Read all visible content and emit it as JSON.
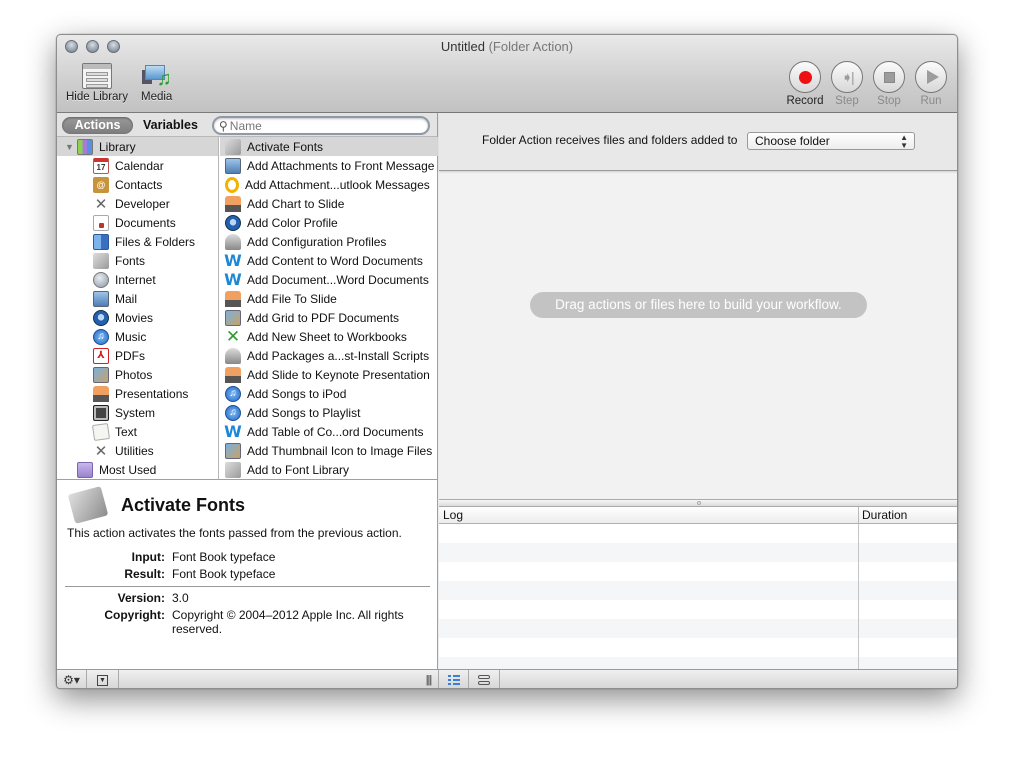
{
  "window": {
    "title": "Untitled",
    "subtitle": "(Folder Action)"
  },
  "toolbar": {
    "hide_library": "Hide Library",
    "media": "Media",
    "record": "Record",
    "step": "Step",
    "stop": "Stop",
    "run": "Run"
  },
  "library": {
    "tab_actions": "Actions",
    "tab_variables": "Variables",
    "search_placeholder": "Name",
    "root": "Library",
    "categories": [
      {
        "label": "Calendar",
        "icon": "calendar-icon"
      },
      {
        "label": "Contacts",
        "icon": "contacts-icon"
      },
      {
        "label": "Developer",
        "icon": "developer-icon"
      },
      {
        "label": "Documents",
        "icon": "documents-icon"
      },
      {
        "label": "Files & Folders",
        "icon": "finder-icon"
      },
      {
        "label": "Fonts",
        "icon": "fonts-icon"
      },
      {
        "label": "Internet",
        "icon": "internet-icon"
      },
      {
        "label": "Mail",
        "icon": "mail-icon"
      },
      {
        "label": "Movies",
        "icon": "movies-icon"
      },
      {
        "label": "Music",
        "icon": "music-icon"
      },
      {
        "label": "PDFs",
        "icon": "pdf-icon"
      },
      {
        "label": "Photos",
        "icon": "photos-icon"
      },
      {
        "label": "Presentations",
        "icon": "presentations-icon"
      },
      {
        "label": "System",
        "icon": "system-icon"
      },
      {
        "label": "Text",
        "icon": "text-icon"
      },
      {
        "label": "Utilities",
        "icon": "utilities-icon"
      }
    ],
    "most_used": "Most Used",
    "actions": [
      {
        "label": "Activate Fonts",
        "icon": "fonts-icon",
        "selected": true
      },
      {
        "label": "Add Attachments to Front Message",
        "icon": "mail-icon"
      },
      {
        "label": "Add Attachment...utlook Messages",
        "icon": "outlook-icon"
      },
      {
        "label": "Add Chart to Slide",
        "icon": "keynote-icon"
      },
      {
        "label": "Add Color Profile",
        "icon": "quicktime-icon"
      },
      {
        "label": "Add Configuration Profiles",
        "icon": "package-icon"
      },
      {
        "label": "Add Content to Word Documents",
        "icon": "word-icon"
      },
      {
        "label": "Add Document...Word Documents",
        "icon": "word-icon"
      },
      {
        "label": "Add File To Slide",
        "icon": "keynote-icon"
      },
      {
        "label": "Add Grid to PDF Documents",
        "icon": "preview-icon"
      },
      {
        "label": "Add New Sheet to Workbooks",
        "icon": "excel-icon"
      },
      {
        "label": "Add Packages a...st-Install Scripts",
        "icon": "package-icon"
      },
      {
        "label": "Add Slide to Keynote Presentation",
        "icon": "keynote-icon"
      },
      {
        "label": "Add Songs to iPod",
        "icon": "itunes-icon"
      },
      {
        "label": "Add Songs to Playlist",
        "icon": "itunes-icon"
      },
      {
        "label": "Add Table of Co...ord Documents",
        "icon": "word-icon"
      },
      {
        "label": "Add Thumbnail Icon to Image Files",
        "icon": "preview-icon"
      },
      {
        "label": "Add to Font Library",
        "icon": "fonts-icon"
      }
    ]
  },
  "description": {
    "title": "Activate Fonts",
    "text": "This action activates the fonts passed from the previous action.",
    "input_label": "Input:",
    "input_value": "Font Book typeface",
    "result_label": "Result:",
    "result_value": "Font Book typeface",
    "version_label": "Version:",
    "version_value": "3.0",
    "copyright_label": "Copyright:",
    "copyright_value": "Copyright © 2004–2012 Apple Inc. All rights reserved."
  },
  "workflow": {
    "receives_label": "Folder Action receives files and folders added to",
    "folder_select": "Choose folder",
    "drop_hint": "Drag actions or files here to build your workflow."
  },
  "log": {
    "col_log": "Log",
    "col_duration": "Duration",
    "rows": []
  },
  "colors": {
    "record_red": "#ee1111",
    "list_mode_blue": "#3a7fd8",
    "selection_gray": "#d6d6d6"
  }
}
